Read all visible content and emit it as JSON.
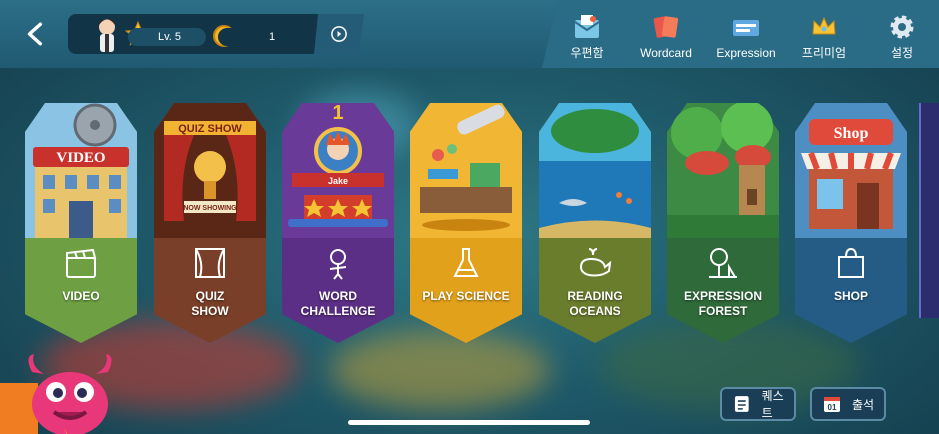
{
  "header": {
    "level_label": "Lv. 5",
    "coin_count": "1"
  },
  "menu": [
    {
      "label": "우편함",
      "icon": "mail-icon"
    },
    {
      "label": "Wordcard",
      "icon": "wordcard-icon"
    },
    {
      "label": "Expression",
      "icon": "expression-icon"
    },
    {
      "label": "프리미엄",
      "icon": "crown-icon"
    },
    {
      "label": "설정",
      "icon": "gear-icon"
    }
  ],
  "cards": [
    {
      "title": "VIDEO",
      "sign": "VIDEO",
      "icon": "clapperboard-icon",
      "color": "#6ea043"
    },
    {
      "title": "QUIZ\nSHOW",
      "sign": "QUIZ SHOW",
      "sub_sign": "NOW SHOWING",
      "icon": "stage-curtain-icon",
      "color": "#7a3f28"
    },
    {
      "title": "WORD\nCHALLENGE",
      "sign": "Jake",
      "badge": "1",
      "icon": "stickman-icon",
      "color": "#5c2f86"
    },
    {
      "title": "PLAY SCIENCE",
      "icon": "flask-icon",
      "color": "#e2a11a"
    },
    {
      "title": "READING\nOCEANS",
      "icon": "whale-icon",
      "color": "#6a7d2d"
    },
    {
      "title": "EXPRESSION\nFOREST",
      "icon": "tree-icon",
      "color": "#2f6a3a"
    },
    {
      "title": "SHOP",
      "sign": "Shop",
      "icon": "shopping-bag-icon",
      "color": "#245c86"
    }
  ],
  "bottom_buttons": [
    {
      "label": "퀘스트",
      "icon": "quest-icon"
    },
    {
      "label": "출석",
      "icon": "calendar-icon",
      "calendar_day": "01"
    }
  ],
  "colors": {
    "accent": "#f3a622",
    "topbar": "#2c6f87"
  }
}
